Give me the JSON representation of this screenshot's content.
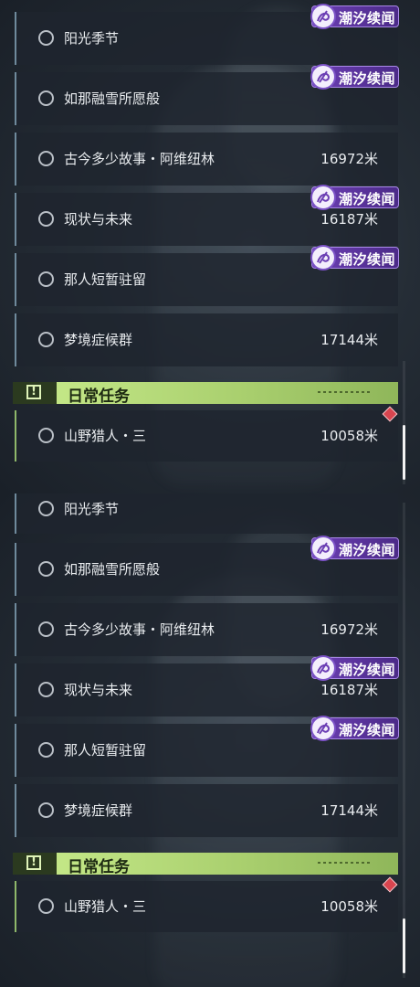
{
  "badge_text": "潮汐续闻",
  "daily_header": "日常任务",
  "quests": [
    {
      "name": "阳光季节",
      "distance": ""
    },
    {
      "name": "如那融雪所愿般",
      "distance": ""
    },
    {
      "name": "古今多少故事・阿维纽林",
      "distance": "16972米"
    },
    {
      "name": "现状与未来",
      "distance": "16187米"
    },
    {
      "name": "那人短暂驻留",
      "distance": ""
    },
    {
      "name": "梦境症候群",
      "distance": "17144米"
    }
  ],
  "daily_quest": {
    "name": "山野猎人・三",
    "distance": "10058米"
  },
  "colors": {
    "badge_purple": "#6c3fb4",
    "daily_green": "#b9e07d",
    "alert_red": "#d9454f"
  },
  "icons": {
    "badge": "tidal-spiral-icon",
    "daily": "exclamation-box-icon",
    "quest": "circle-icon",
    "alert": "diamond-alert-icon"
  }
}
